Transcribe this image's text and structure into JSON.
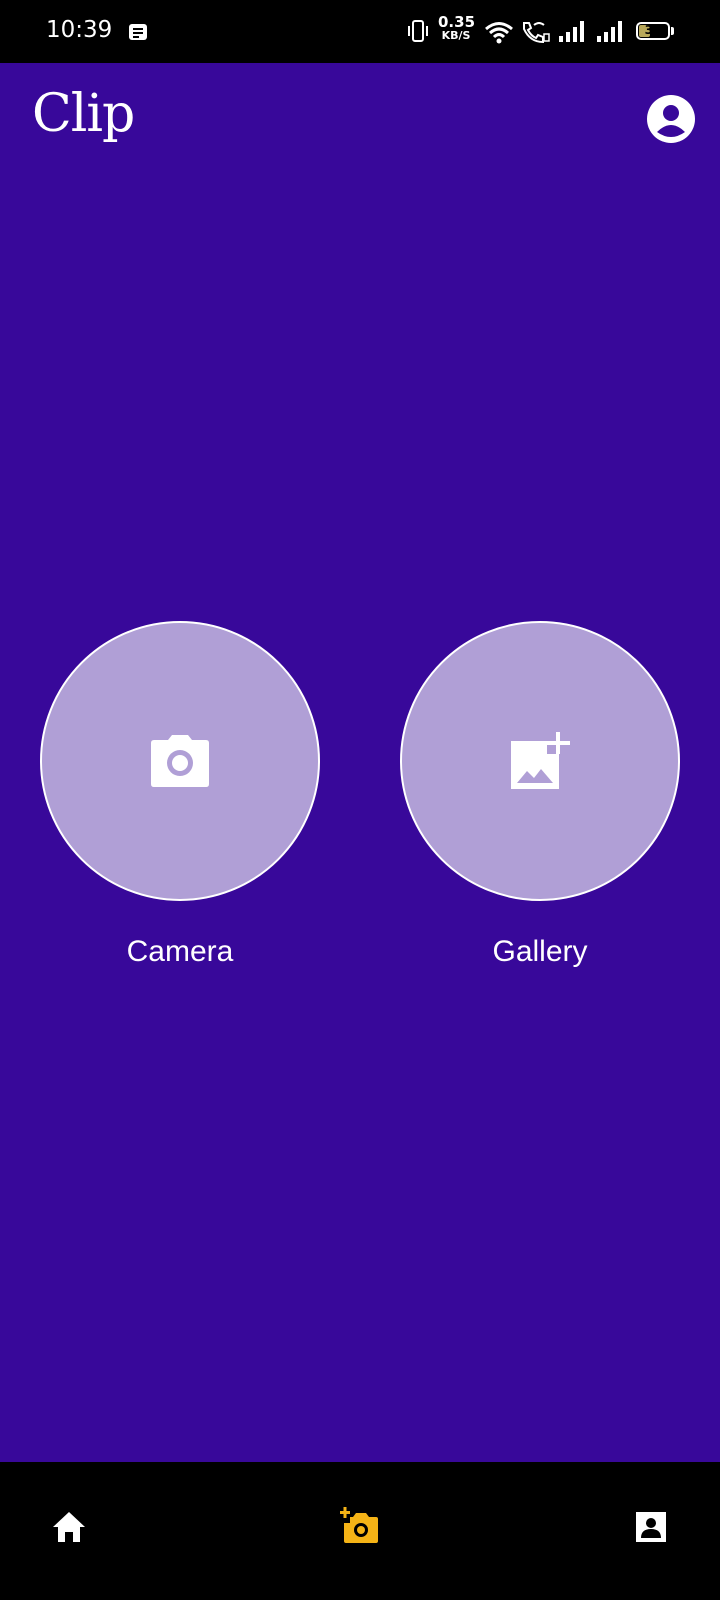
{
  "status_bar": {
    "time": "10:39",
    "net_speed_value": "0.35",
    "net_speed_unit": "KB/S",
    "battery_level": "37",
    "icons": [
      "notification-icon",
      "vibrate-icon",
      "wifi-icon",
      "wifi-calling-icon",
      "signal-icon",
      "signal-icon",
      "battery-icon"
    ]
  },
  "header": {
    "title": "Clip",
    "account_icon": "account-circle-icon"
  },
  "actions": [
    {
      "label": "Camera",
      "icon": "camera-icon"
    },
    {
      "label": "Gallery",
      "icon": "add-photo-icon"
    }
  ],
  "bottom_nav": {
    "items": [
      {
        "icon": "home-icon",
        "active": false
      },
      {
        "icon": "add-camera-icon",
        "active": true
      },
      {
        "icon": "profile-icon",
        "active": false
      }
    ],
    "active_color": "#f5b316"
  },
  "colors": {
    "background": "#38089a",
    "circle_fill": "#b09fd6",
    "circle_border": "#ffffff",
    "bars": "#000000"
  }
}
